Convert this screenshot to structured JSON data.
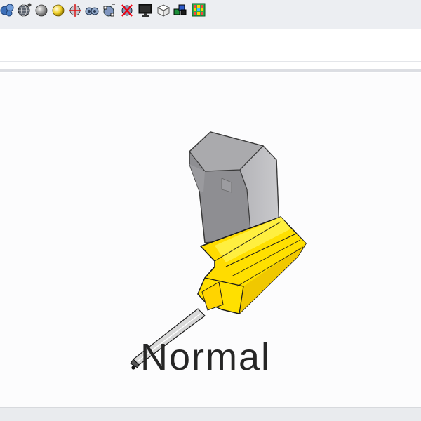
{
  "toolbar": {
    "buttons": [
      {
        "icon": "multi-sphere-icon"
      },
      {
        "icon": "wireframe-sphere-icon"
      },
      {
        "icon": "shaded-sphere-icon"
      },
      {
        "icon": "rendered-sphere-icon"
      },
      {
        "icon": "crosshair-sphere-icon"
      },
      {
        "icon": "binocular-sphere-icon"
      },
      {
        "icon": "select-sphere-icon"
      },
      {
        "icon": "delete-sphere-icon"
      },
      {
        "icon": "monitor-icon"
      },
      {
        "icon": "box-wireframe-icon"
      },
      {
        "icon": "colored-cubes-icon"
      },
      {
        "icon": "color-grid-icon"
      }
    ]
  },
  "viewport": {
    "mode_label": "Normal"
  },
  "colors": {
    "handle_yellow": "#ffdd00",
    "cursor_gray": "#9a9a9e",
    "label_text": "#262626",
    "toolbar_bg": "#eceef2"
  }
}
